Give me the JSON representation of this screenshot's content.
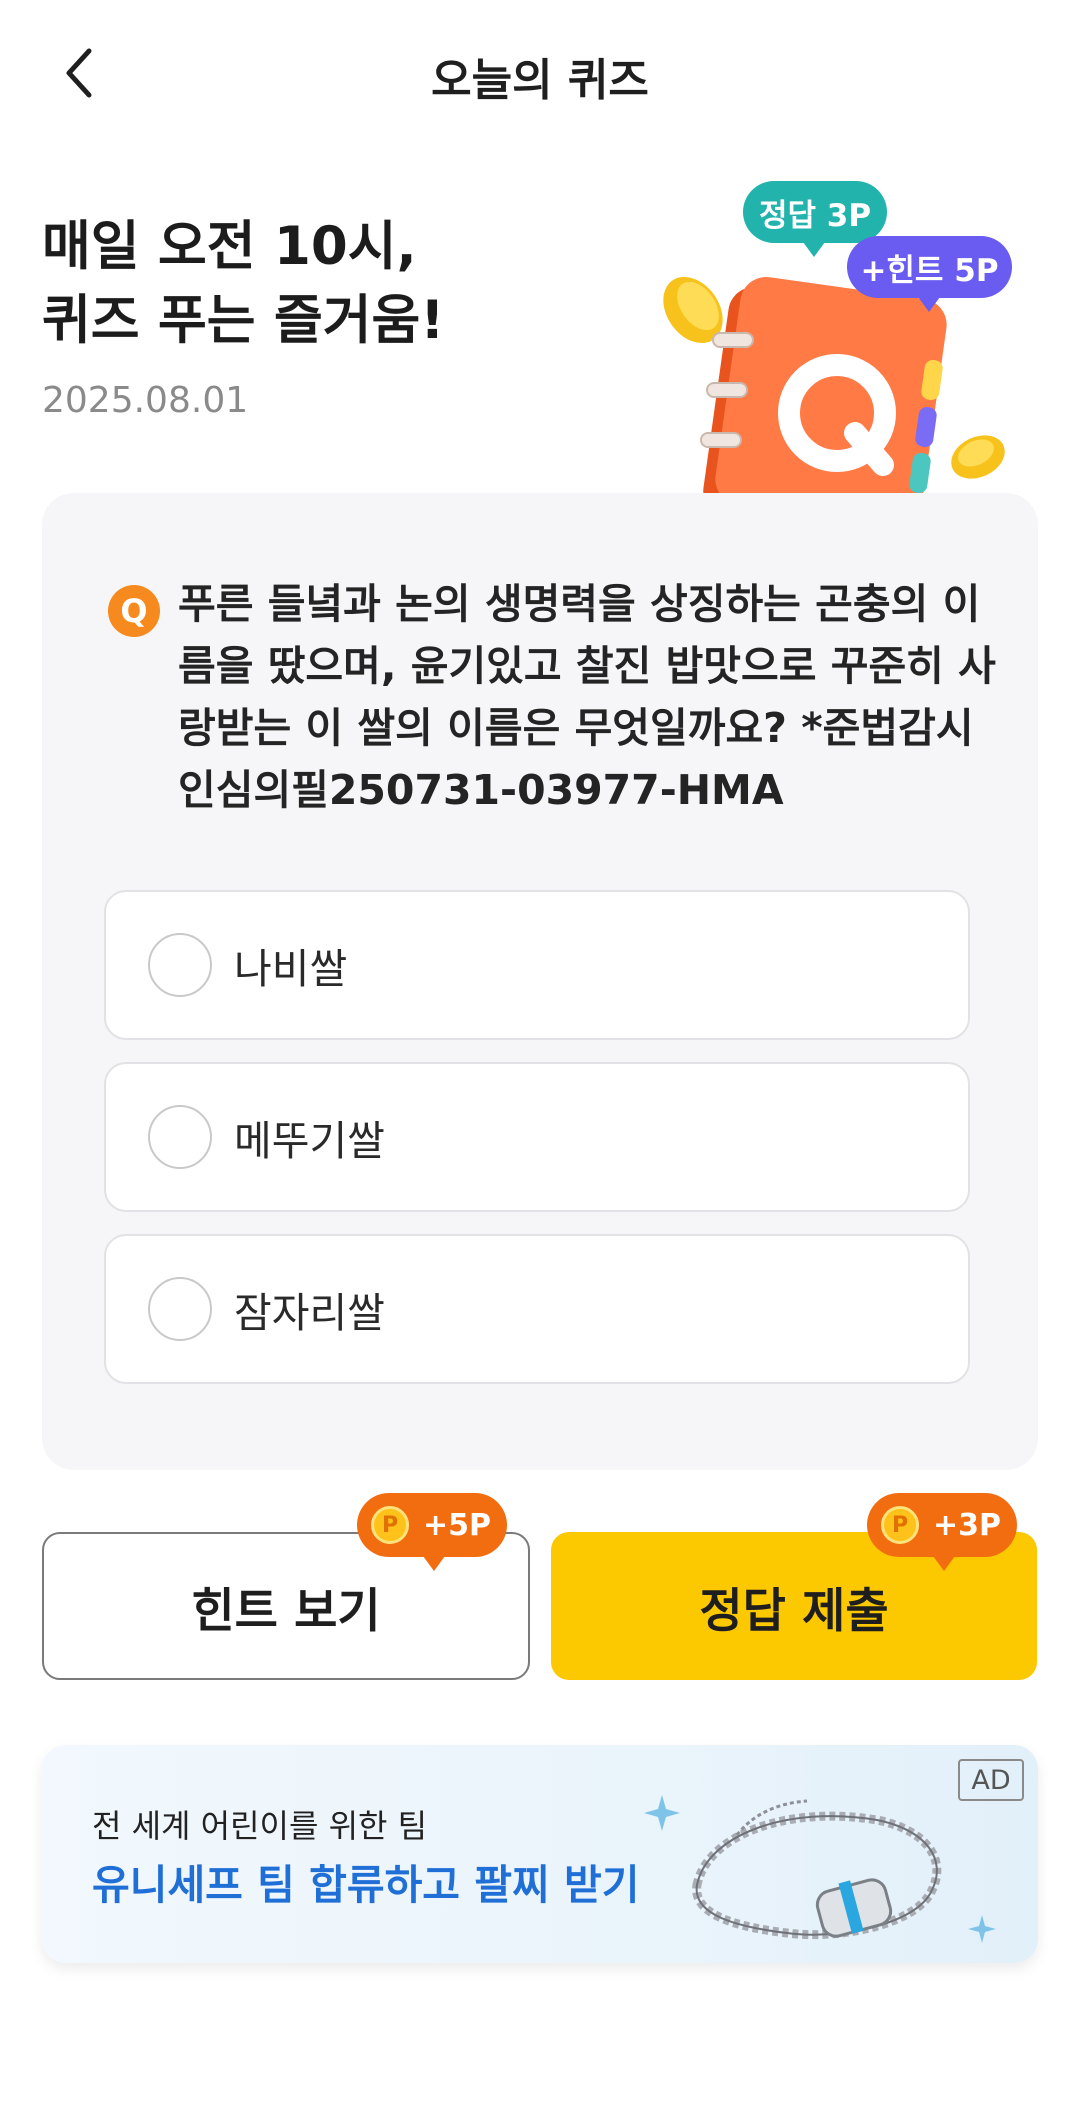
{
  "header": {
    "title": "오늘의 퀴즈",
    "back_icon": "chevron-left-icon"
  },
  "hero": {
    "title_lines": [
      "매일 오전 10시,",
      "퀴즈 푸는 즐거움!"
    ],
    "date": "2025.08.01",
    "bubble_answer": "정답 3P",
    "bubble_hint": "+힌트 5P",
    "illustration_letter": "Q"
  },
  "quiz": {
    "badge": "Q",
    "question_lines": [
      "푸른 들녘과 논의 생명력을 상징하는 곤충의 이",
      "름을 땄으며, 윤기있고 찰진 밥맛으로 꾸준히 사",
      "랑받는 이 쌀의 이름은 무엇일까요? *준법감시",
      "인심의필250731-03977-HMA"
    ],
    "options": [
      {
        "label": "나비쌀",
        "selected": false
      },
      {
        "label": "메뚜기쌀",
        "selected": false
      },
      {
        "label": "잠자리쌀",
        "selected": false
      }
    ]
  },
  "actions": {
    "hint_label": "힌트 보기",
    "hint_reward": "+5P",
    "submit_label": "정답 제출",
    "submit_reward": "+3P",
    "coin_letter": "P"
  },
  "ad": {
    "badge": "AD",
    "subtitle": "전 세계 어린이를 위한 팀",
    "headline": "유니세프 팀 합류하고 팔찌 받기"
  },
  "colors": {
    "accent_yellow": "#fcc800",
    "reward_orange": "#f26d0f",
    "bubble_teal": "#22b3ad",
    "bubble_purple": "#6a5cf0",
    "ad_blue": "#1f6fd6"
  }
}
